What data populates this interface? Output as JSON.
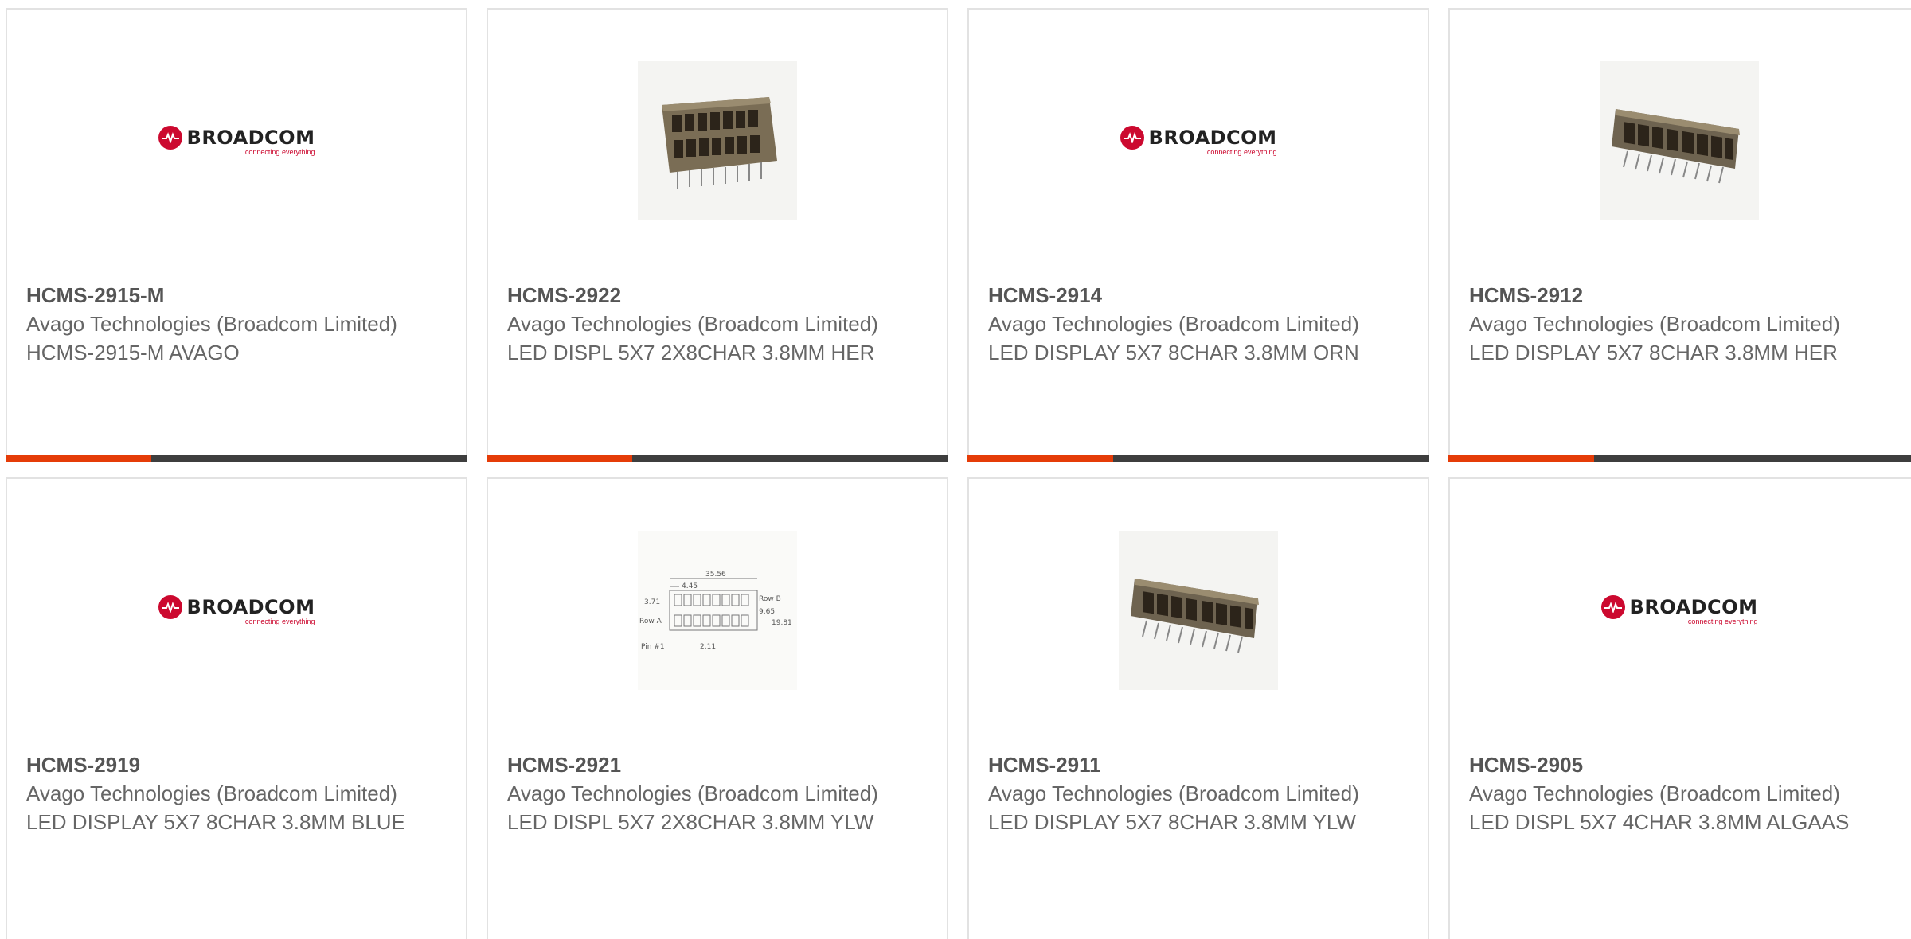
{
  "products": [
    {
      "part": "HCMS-2915-M",
      "manufacturer": "Avago Technologies (Broadcom Limited)",
      "description": "HCMS-2915-M AVAGO",
      "image": "broadcom-logo"
    },
    {
      "part": "HCMS-2922",
      "manufacturer": "Avago Technologies (Broadcom Limited)",
      "description": "LED DISPL 5X7 2X8CHAR 3.8MM HER",
      "image": "led-display-2x8-photo"
    },
    {
      "part": "HCMS-2914",
      "manufacturer": "Avago Technologies (Broadcom Limited)",
      "description": "LED DISPLAY 5X7 8CHAR 3.8MM ORN",
      "image": "broadcom-logo"
    },
    {
      "part": "HCMS-2912",
      "manufacturer": "Avago Technologies (Broadcom Limited)",
      "description": "LED DISPLAY 5X7 8CHAR 3.8MM HER",
      "image": "led-display-8char-photo"
    },
    {
      "part": "HCMS-2919",
      "manufacturer": "Avago Technologies (Broadcom Limited)",
      "description": "LED DISPLAY 5X7 8CHAR 3.8MM BLUE",
      "image": "broadcom-logo"
    },
    {
      "part": "HCMS-2921",
      "manufacturer": "Avago Technologies (Broadcom Limited)",
      "description": "LED DISPL 5X7 2X8CHAR 3.8MM YLW",
      "image": "dimension-drawing"
    },
    {
      "part": "HCMS-2911",
      "manufacturer": "Avago Technologies (Broadcom Limited)",
      "description": "LED DISPLAY 5X7 8CHAR 3.8MM YLW",
      "image": "led-display-8char-photo"
    },
    {
      "part": "HCMS-2905",
      "manufacturer": "Avago Technologies (Broadcom Limited)",
      "description": "LED DISPL 5X7 4CHAR 3.8MM ALGAAS",
      "image": "broadcom-logo"
    }
  ],
  "logo": {
    "word": "BROADCOM",
    "tagline": "connecting everything"
  },
  "drawing": {
    "dim_top": "35.56",
    "dim_pitch": "4.45",
    "dim_left": "3.71",
    "dim_right": "9.65",
    "dim_height": "19.81",
    "dim_pin": "2.11",
    "row_a": "Row A",
    "row_b": "Row B",
    "pin1": "Pin #1"
  },
  "colors": {
    "accent": "#e53c08",
    "bar": "#3e3e3e",
    "logo_red": "#cc092f"
  }
}
